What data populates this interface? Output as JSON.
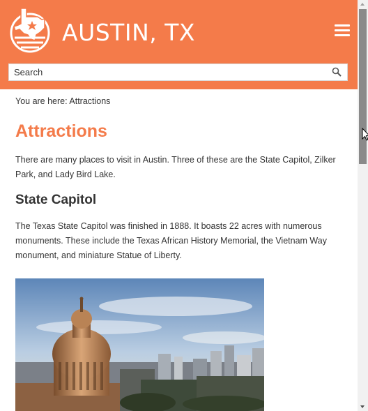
{
  "header": {
    "site_title": "AUSTIN, TX",
    "logo_icon": "texas-star-logo-icon",
    "menu_icon": "hamburger-menu-icon",
    "brand_color": "#f47b4a"
  },
  "search": {
    "placeholder": "Search",
    "icon": "search-icon"
  },
  "breadcrumb": "You are here: Attractions",
  "main": {
    "title": "Attractions",
    "intro": "There are many places to visit in Austin. Three of these are the State Capitol, Zilker Park, and Lady Bird Lake.",
    "sections": [
      {
        "heading": "State Capitol",
        "body": "The Texas State Capitol was finished in 1888. It boasts 22 acres with numerous monuments. These include the Texas African History Memorial, the Vietnam Way monument, and miniature Statue of Liberty."
      }
    ]
  }
}
